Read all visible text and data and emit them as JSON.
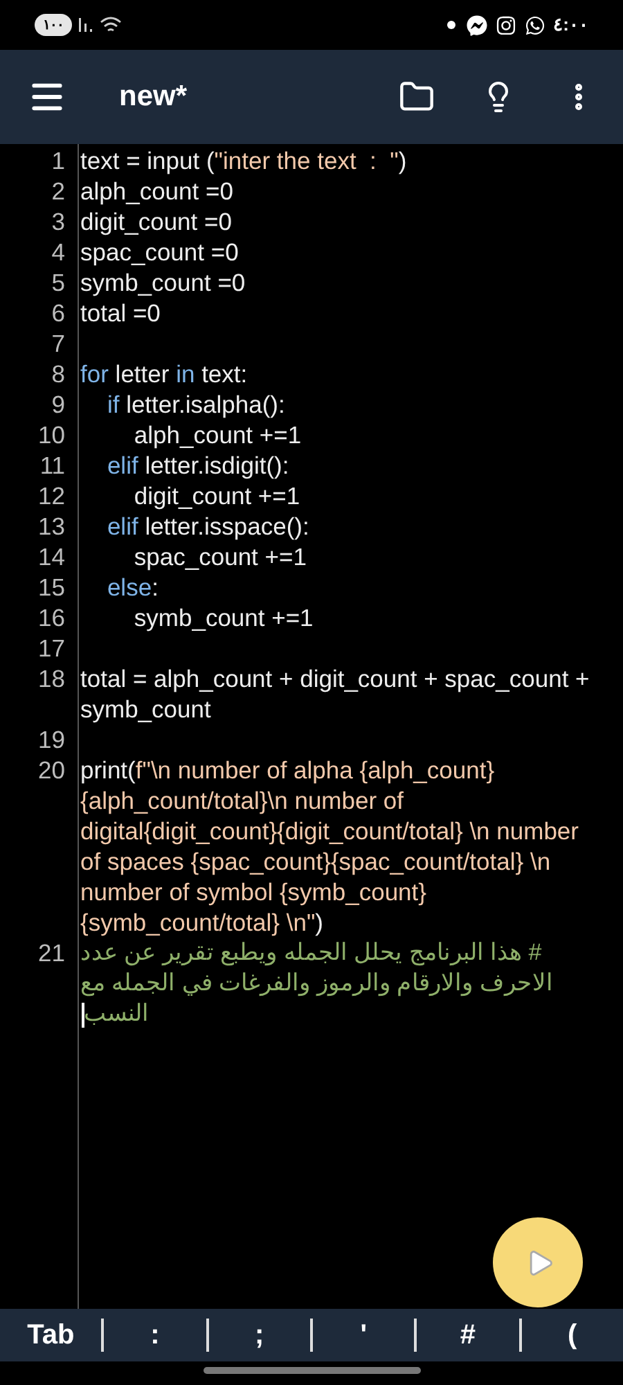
{
  "status_bar": {
    "battery": "١٠٠",
    "time": "٤:٠٠"
  },
  "toolbar": {
    "title": "new*"
  },
  "editor": {
    "lines": [
      {
        "number": "1",
        "segments": [
          {
            "kind": "plain",
            "text": "text = input ("
          },
          {
            "kind": "string",
            "text": "\"inter the text  :  \""
          },
          {
            "kind": "plain",
            "text": ")"
          }
        ]
      },
      {
        "number": "2",
        "segments": [
          {
            "kind": "plain",
            "text": "alph_count =0"
          }
        ]
      },
      {
        "number": "3",
        "segments": [
          {
            "kind": "plain",
            "text": "digit_count =0"
          }
        ]
      },
      {
        "number": "4",
        "segments": [
          {
            "kind": "plain",
            "text": "spac_count =0"
          }
        ]
      },
      {
        "number": "5",
        "segments": [
          {
            "kind": "plain",
            "text": "symb_count =0"
          }
        ]
      },
      {
        "number": "6",
        "segments": [
          {
            "kind": "plain",
            "text": "total =0"
          }
        ]
      },
      {
        "number": "7"
      },
      {
        "number": "8",
        "segments": [
          {
            "kind": "keyword",
            "text": "for"
          },
          {
            "kind": "plain",
            "text": " letter "
          },
          {
            "kind": "keyword",
            "text": "in"
          },
          {
            "kind": "plain",
            "text": " text:"
          }
        ]
      },
      {
        "number": "9",
        "segments": [
          {
            "kind": "keyword",
            "text": "    if"
          },
          {
            "kind": "plain",
            "text": " letter.isalpha():"
          }
        ]
      },
      {
        "number": "10",
        "segments": [
          {
            "kind": "plain",
            "text": "        alph_count +=1"
          }
        ]
      },
      {
        "number": "11",
        "segments": [
          {
            "kind": "keyword",
            "text": "    elif"
          },
          {
            "kind": "plain",
            "text": " letter.isdigit():"
          }
        ]
      },
      {
        "number": "12",
        "segments": [
          {
            "kind": "plain",
            "text": "        digit_count +=1"
          }
        ]
      },
      {
        "number": "13",
        "segments": [
          {
            "kind": "keyword",
            "text": "    elif"
          },
          {
            "kind": "plain",
            "text": " letter.isspace():"
          }
        ]
      },
      {
        "number": "14",
        "segments": [
          {
            "kind": "plain",
            "text": "        spac_count +=1"
          }
        ]
      },
      {
        "number": "15",
        "segments": [
          {
            "kind": "keyword",
            "text": "    else"
          },
          {
            "kind": "plain",
            "text": ":"
          }
        ]
      },
      {
        "number": "16",
        "segments": [
          {
            "kind": "plain",
            "text": "        symb_count +=1"
          }
        ]
      },
      {
        "number": "17"
      },
      {
        "number": "18",
        "segments": [
          {
            "kind": "plain",
            "text": "total = alph_count + digit_count + spac_count + symb_count"
          }
        ]
      },
      {
        "number": "19"
      },
      {
        "number": "20",
        "segments": [
          {
            "kind": "plain",
            "text": "print("
          },
          {
            "kind": "string",
            "text": "f\"\\n number of alpha {alph_count}{alph_count/total}\\n number of digital{digit_count}{digit_count/total} \\n number of spaces {spac_count}{spac_count/total} \\n number of symbol {symb_count}{symb_count/total} \\n\""
          },
          {
            "kind": "plain",
            "text": ")"
          }
        ]
      },
      {
        "number": "21",
        "segments": [
          {
            "kind": "comment",
            "text": "# هذا البرنامج يحلل الجمله ويطبع تقرير عن عدد الاحرف والارقام والرموز والفرغات في الجمله مع النسب"
          }
        ],
        "cursor": true
      }
    ]
  },
  "key_bar": {
    "keys": [
      "Tab",
      ":",
      ";",
      "'",
      "#",
      "("
    ]
  }
}
